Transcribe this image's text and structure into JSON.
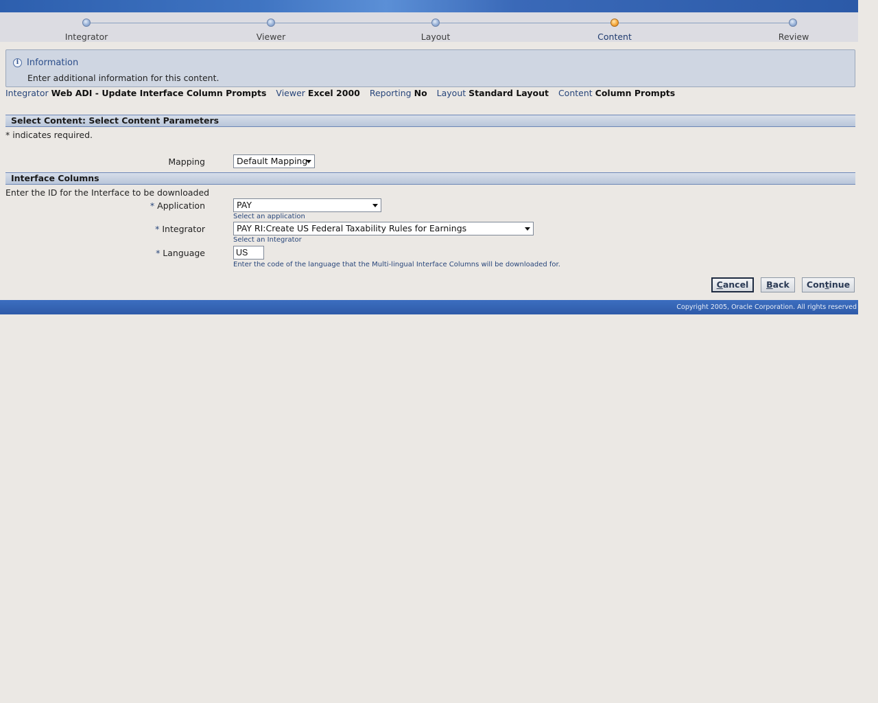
{
  "train": {
    "steps": [
      {
        "label": "Integrator"
      },
      {
        "label": "Viewer"
      },
      {
        "label": "Layout"
      },
      {
        "label": "Content"
      },
      {
        "label": "Review"
      }
    ],
    "active_step": "Content"
  },
  "info": {
    "icon": "info-icon",
    "title": "Information",
    "text": "Enter additional information for this content."
  },
  "summary": {
    "integrator_label": "Integrator",
    "integrator_value": "Web ADI - Update Interface Column Prompts",
    "viewer_label": "Viewer",
    "viewer_value": "Excel 2000",
    "reporting_label": "Reporting",
    "reporting_value": "No",
    "layout_label": "Layout",
    "layout_value": "Standard Layout",
    "content_label": "Content",
    "content_value": "Column Prompts"
  },
  "select_content": {
    "header": "Select Content: Select Content Parameters",
    "required_note": "* indicates required.",
    "mapping_label": "Mapping",
    "mapping_value": "Default Mapping"
  },
  "interface_columns": {
    "header": "Interface Columns",
    "instruction": "Enter the ID for the Interface to be downloaded",
    "application_label": "Application",
    "application_value": "PAY",
    "application_hint": "Select an application",
    "integrator_label": "Integrator",
    "integrator_value": "PAY RI:Create US Federal Taxability Rules for Earnings",
    "integrator_hint": "Select an Integrator",
    "language_label": "Language",
    "language_value": "US",
    "language_hint": "Enter the code of the language that the Multi-lingual Interface Columns will be downloaded for.",
    "required_mark": "*"
  },
  "buttons": {
    "cancel_prefix": "",
    "cancel_key": "C",
    "cancel_rest": "ancel",
    "back_key": "B",
    "back_rest": "ack",
    "continue_prefix": "Con",
    "continue_key": "t",
    "continue_rest": "inue"
  },
  "footer": {
    "copyright": "Copyright 2005, Oracle Corporation. All rights reserved"
  },
  "colors": {
    "accent": "#2e5aa8",
    "active_step": "#f6a83c"
  }
}
